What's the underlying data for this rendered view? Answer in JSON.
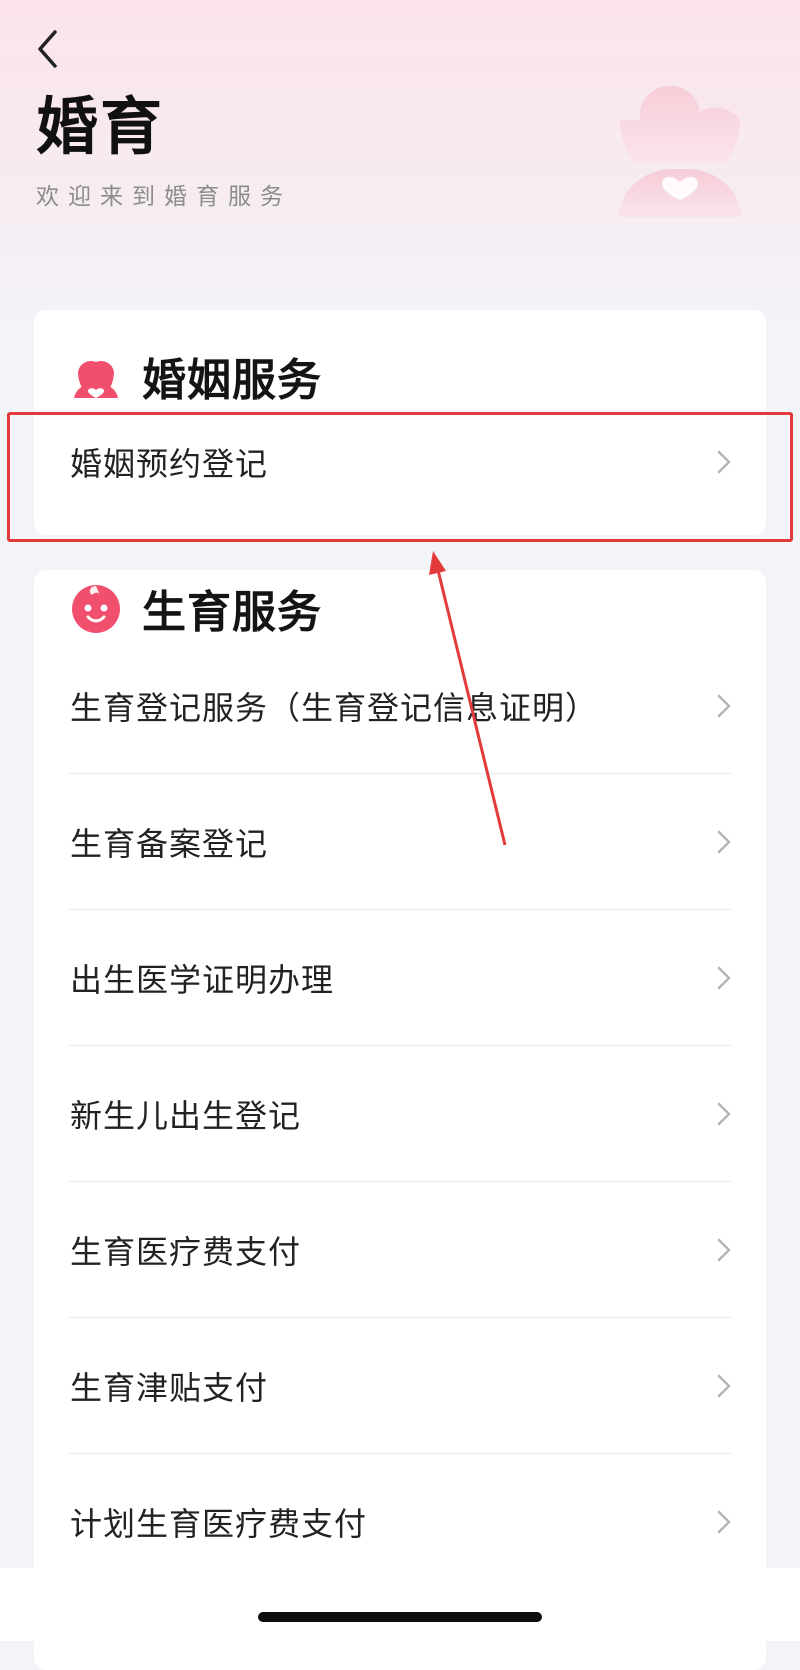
{
  "header": {
    "title": "婚育",
    "subtitle": "欢迎来到婚育服务"
  },
  "icons": {
    "back": "chevron-left-icon",
    "hero": "couple-heart-illustration",
    "marriage": "couple-icon",
    "birth": "baby-face-icon",
    "row_arrow": "chevron-right-icon"
  },
  "colors": {
    "accent": "#f0506e",
    "highlight": "#e33b3b",
    "header_gradient_top": "#fbe4ea",
    "background": "#f3f3f8"
  },
  "marriage_section": {
    "title": "婚姻服务",
    "items": [
      {
        "label": "婚姻预约登记"
      }
    ]
  },
  "birth_section": {
    "title": "生育服务",
    "items": [
      {
        "label": "生育登记服务（生育登记信息证明）"
      },
      {
        "label": "生育备案登记"
      },
      {
        "label": "出生医学证明办理"
      },
      {
        "label": "新生儿出生登记"
      },
      {
        "label": "生育医疗费支付"
      },
      {
        "label": "生育津贴支付"
      },
      {
        "label": "计划生育医疗费支付"
      }
    ]
  }
}
